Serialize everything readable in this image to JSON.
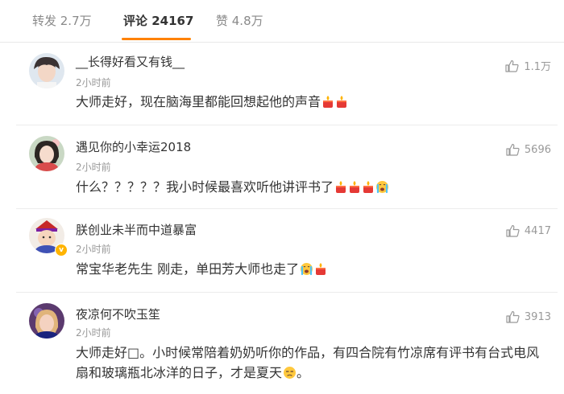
{
  "tabs": [
    {
      "label": "转发 2.7万"
    },
    {
      "label": "评论 24167"
    },
    {
      "label": "赞 4.8万"
    }
  ],
  "accent_color": "#ff8200",
  "comments": [
    {
      "username": "__长得好看又有钱__",
      "time": "2小时前",
      "text": "大师走好，现在脑海里都能回想起他的声音",
      "emojis": [
        "candle-emoji",
        "candle-emoji"
      ],
      "likes": "1.1万"
    },
    {
      "username": "遇见你的小幸运2018",
      "time": "2小时前",
      "text": "什么？？？？？我小时候最喜欢听他讲评书了",
      "emojis": [
        "candle-emoji",
        "candle-emoji",
        "candle-emoji",
        "crying-emoji"
      ],
      "likes": "5696"
    },
    {
      "username": "朕创业未半而中道暴富",
      "time": "2小时前",
      "text": "常宝华老先生 刚走，单田芳大师也走了",
      "emojis": [
        "crying-emoji",
        "candle-emoji"
      ],
      "likes": "4417"
    },
    {
      "username": "夜凉何不吹玉笙",
      "time": "2小时前",
      "text": "大师走好□。小时候常陪着奶奶听你的作品，有四合院有竹凉席有评书有台式电风扇和玻璃瓶北冰洋的日子，才是夏天",
      "emojis": [
        "sad-emoji",
        "period-text"
      ],
      "likes": "3913"
    }
  ],
  "period_char": "。"
}
